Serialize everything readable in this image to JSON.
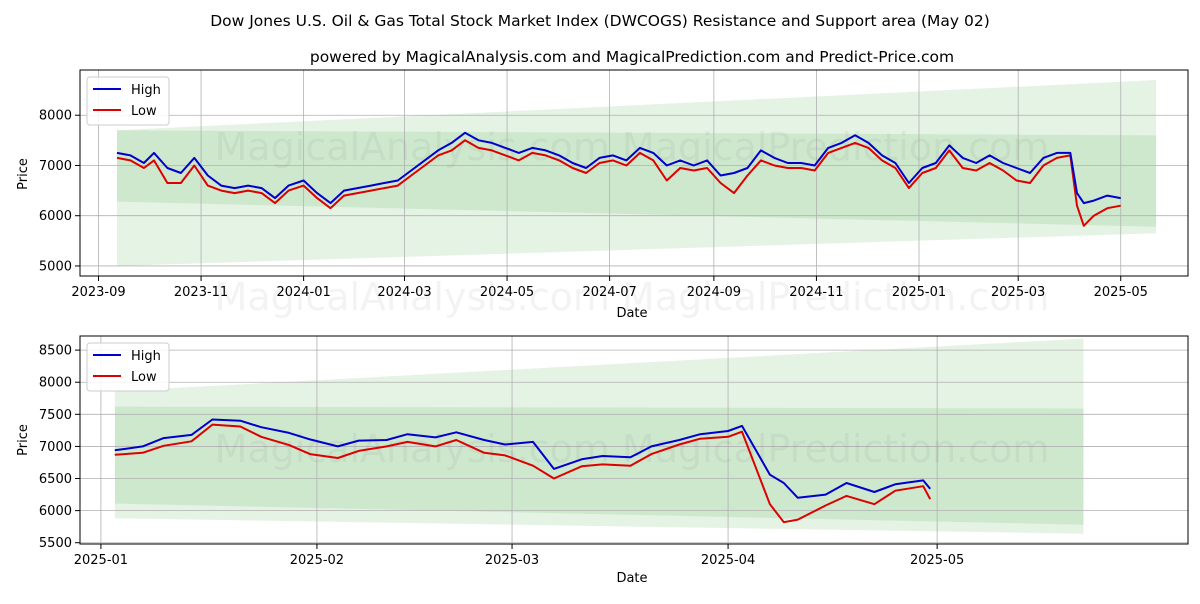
{
  "title": "Dow Jones U.S. Oil & Gas Total Stock Market Index (DWCOGS) Resistance and Support area (May 02)",
  "subtitle": "powered by MagicalAnalysis.com and MagicalPrediction.com and Predict-Price.com",
  "watermark": "MagicalAnalysis.com    MagicalPrediction.com",
  "colors": {
    "high": "#0000cc",
    "low": "#dd0000",
    "band": "#2ca02c",
    "grid": "#b0b0b0"
  },
  "chart_data": [
    {
      "type": "line",
      "xlabel": "Date",
      "ylabel": "Price",
      "legend_position": "top-left",
      "grid": true,
      "xlim": [
        "2023-08-21",
        "2025-06-10"
      ],
      "ylim": [
        4800,
        8900
      ],
      "x_ticks": [
        "2023-09",
        "2023-11",
        "2024-01",
        "2024-03",
        "2024-05",
        "2024-07",
        "2024-09",
        "2024-11",
        "2025-01",
        "2025-03",
        "2025-05"
      ],
      "y_ticks": [
        5000,
        6000,
        7000,
        8000
      ],
      "bands": [
        {
          "x": [
            "2023-09-12",
            "2025-05-22"
          ],
          "upper": [
            7700,
            8700
          ],
          "lower": [
            5000,
            5650
          ]
        },
        {
          "x": [
            "2023-09-12",
            "2025-05-22"
          ],
          "upper": [
            7700,
            7600
          ],
          "lower": [
            6280,
            5780
          ]
        },
        {
          "x": [
            "2023-09-12",
            "2025-05-22"
          ],
          "upper": [
            7600,
            5780
          ],
          "lower": [
            7600,
            5780
          ]
        }
      ],
      "series": [
        {
          "name": "High",
          "x": [
            "2023-09-12",
            "2023-09-20",
            "2023-09-28",
            "2023-10-04",
            "2023-10-12",
            "2023-10-20",
            "2023-10-28",
            "2023-11-05",
            "2023-11-13",
            "2023-11-21",
            "2023-11-29",
            "2023-12-07",
            "2023-12-15",
            "2023-12-23",
            "2024-01-01",
            "2024-01-09",
            "2024-01-17",
            "2024-01-25",
            "2024-02-02",
            "2024-02-10",
            "2024-02-18",
            "2024-02-26",
            "2024-03-05",
            "2024-03-13",
            "2024-03-21",
            "2024-03-29",
            "2024-04-06",
            "2024-04-14",
            "2024-04-22",
            "2024-04-30",
            "2024-05-08",
            "2024-05-16",
            "2024-05-24",
            "2024-06-01",
            "2024-06-09",
            "2024-06-17",
            "2024-06-25",
            "2024-07-03",
            "2024-07-11",
            "2024-07-19",
            "2024-07-27",
            "2024-08-04",
            "2024-08-12",
            "2024-08-20",
            "2024-08-28",
            "2024-09-05",
            "2024-09-13",
            "2024-09-21",
            "2024-09-29",
            "2024-10-07",
            "2024-10-15",
            "2024-10-23",
            "2024-10-31",
            "2024-11-08",
            "2024-11-16",
            "2024-11-24",
            "2024-12-02",
            "2024-12-10",
            "2024-12-18",
            "2024-12-26",
            "2025-01-03",
            "2025-01-11",
            "2025-01-19",
            "2025-01-27",
            "2025-02-04",
            "2025-02-12",
            "2025-02-20",
            "2025-02-28",
            "2025-03-08",
            "2025-03-16",
            "2025-03-24",
            "2025-04-01",
            "2025-04-05",
            "2025-04-09",
            "2025-04-15",
            "2025-04-23",
            "2025-05-01"
          ],
          "values": [
            7250,
            7200,
            7050,
            7250,
            6950,
            6850,
            7150,
            6800,
            6600,
            6550,
            6600,
            6550,
            6350,
            6600,
            6700,
            6450,
            6250,
            6500,
            6550,
            6600,
            6650,
            6700,
            6900,
            7100,
            7300,
            7450,
            7650,
            7500,
            7450,
            7350,
            7250,
            7350,
            7300,
            7200,
            7050,
            6950,
            7150,
            7200,
            7100,
            7350,
            7250,
            7000,
            7100,
            7000,
            7100,
            6800,
            6850,
            6950,
            7300,
            7150,
            7050,
            7050,
            7000,
            7350,
            7450,
            7600,
            7450,
            7200,
            7050,
            6650,
            6950,
            7050,
            7400,
            7150,
            7050,
            7200,
            7050,
            6950,
            6850,
            7150,
            7250,
            7250,
            6450,
            6250,
            6300,
            6400,
            6350
          ]
        },
        {
          "name": "Low",
          "x": [
            "2023-09-12",
            "2023-09-20",
            "2023-09-28",
            "2023-10-04",
            "2023-10-12",
            "2023-10-20",
            "2023-10-28",
            "2023-11-05",
            "2023-11-13",
            "2023-11-21",
            "2023-11-29",
            "2023-12-07",
            "2023-12-15",
            "2023-12-23",
            "2024-01-01",
            "2024-01-09",
            "2024-01-17",
            "2024-01-25",
            "2024-02-02",
            "2024-02-10",
            "2024-02-18",
            "2024-02-26",
            "2024-03-05",
            "2024-03-13",
            "2024-03-21",
            "2024-03-29",
            "2024-04-06",
            "2024-04-14",
            "2024-04-22",
            "2024-04-30",
            "2024-05-08",
            "2024-05-16",
            "2024-05-24",
            "2024-06-01",
            "2024-06-09",
            "2024-06-17",
            "2024-06-25",
            "2024-07-03",
            "2024-07-11",
            "2024-07-19",
            "2024-07-27",
            "2024-08-04",
            "2024-08-12",
            "2024-08-20",
            "2024-08-28",
            "2024-09-05",
            "2024-09-13",
            "2024-09-21",
            "2024-09-29",
            "2024-10-07",
            "2024-10-15",
            "2024-10-23",
            "2024-10-31",
            "2024-11-08",
            "2024-11-16",
            "2024-11-24",
            "2024-12-02",
            "2024-12-10",
            "2024-12-18",
            "2024-12-26",
            "2025-01-03",
            "2025-01-11",
            "2025-01-19",
            "2025-01-27",
            "2025-02-04",
            "2025-02-12",
            "2025-02-20",
            "2025-02-28",
            "2025-03-08",
            "2025-03-16",
            "2025-03-24",
            "2025-04-01",
            "2025-04-05",
            "2025-04-09",
            "2025-04-15",
            "2025-04-23",
            "2025-05-01"
          ],
          "values": [
            7150,
            7100,
            6950,
            7100,
            6650,
            6650,
            7000,
            6600,
            6500,
            6450,
            6500,
            6450,
            6250,
            6500,
            6600,
            6350,
            6150,
            6400,
            6450,
            6500,
            6550,
            6600,
            6800,
            7000,
            7200,
            7300,
            7500,
            7350,
            7300,
            7200,
            7100,
            7250,
            7200,
            7100,
            6950,
            6850,
            7050,
            7100,
            7000,
            7250,
            7100,
            6700,
            6950,
            6900,
            6950,
            6650,
            6450,
            6800,
            7100,
            7000,
            6950,
            6950,
            6900,
            7250,
            7350,
            7450,
            7350,
            7100,
            6950,
            6550,
            6850,
            6950,
            7300,
            6950,
            6900,
            7050,
            6900,
            6700,
            6650,
            7000,
            7150,
            7200,
            6200,
            5800,
            6000,
            6150,
            6200
          ]
        }
      ]
    },
    {
      "type": "line",
      "xlabel": "Date",
      "ylabel": "Price",
      "legend_position": "top-left",
      "grid": true,
      "xlim": [
        "2024-12-29",
        "2025-06-06"
      ],
      "ylim": [
        5480,
        8720
      ],
      "x_ticks": [
        "2025-01",
        "2025-02",
        "2025-03",
        "2025-04",
        "2025-05"
      ],
      "y_ticks": [
        5500,
        6000,
        6500,
        7000,
        7500,
        8000,
        8500
      ],
      "bands": [
        {
          "x": [
            "2025-01-03",
            "2025-05-22"
          ],
          "upper": [
            7860,
            8680
          ],
          "lower": [
            5880,
            5640
          ]
        },
        {
          "x": [
            "2025-01-03",
            "2025-05-22"
          ],
          "upper": [
            7620,
            7590
          ],
          "lower": [
            6110,
            5780
          ]
        }
      ],
      "series": [
        {
          "name": "High",
          "x": [
            "2025-01-03",
            "2025-01-07",
            "2025-01-10",
            "2025-01-14",
            "2025-01-17",
            "2025-01-21",
            "2025-01-24",
            "2025-01-28",
            "2025-01-31",
            "2025-02-04",
            "2025-02-07",
            "2025-02-11",
            "2025-02-14",
            "2025-02-18",
            "2025-02-21",
            "2025-02-25",
            "2025-02-28",
            "2025-03-04",
            "2025-03-07",
            "2025-03-11",
            "2025-03-14",
            "2025-03-18",
            "2025-03-21",
            "2025-03-25",
            "2025-03-28",
            "2025-04-01",
            "2025-04-03",
            "2025-04-07",
            "2025-04-09",
            "2025-04-11",
            "2025-04-15",
            "2025-04-18",
            "2025-04-22",
            "2025-04-25",
            "2025-04-29",
            "2025-04-30"
          ],
          "values": [
            6940,
            7000,
            7130,
            7180,
            7420,
            7400,
            7300,
            7210,
            7110,
            7000,
            7090,
            7100,
            7190,
            7140,
            7220,
            7100,
            7030,
            7070,
            6650,
            6800,
            6850,
            6830,
            7000,
            7100,
            7190,
            7240,
            7320,
            6560,
            6430,
            6200,
            6250,
            6430,
            6290,
            6410,
            6470,
            6340
          ]
        },
        {
          "name": "Low",
          "x": [
            "2025-01-03",
            "2025-01-07",
            "2025-01-10",
            "2025-01-14",
            "2025-01-17",
            "2025-01-21",
            "2025-01-24",
            "2025-01-28",
            "2025-01-31",
            "2025-02-04",
            "2025-02-07",
            "2025-02-11",
            "2025-02-14",
            "2025-02-18",
            "2025-02-21",
            "2025-02-25",
            "2025-02-28",
            "2025-03-04",
            "2025-03-07",
            "2025-03-11",
            "2025-03-14",
            "2025-03-18",
            "2025-03-21",
            "2025-03-25",
            "2025-03-28",
            "2025-04-01",
            "2025-04-03",
            "2025-04-07",
            "2025-04-09",
            "2025-04-11",
            "2025-04-15",
            "2025-04-18",
            "2025-04-22",
            "2025-04-25",
            "2025-04-29",
            "2025-04-30"
          ],
          "values": [
            6870,
            6900,
            7010,
            7080,
            7340,
            7310,
            7150,
            7020,
            6880,
            6820,
            6930,
            7000,
            7070,
            7000,
            7100,
            6900,
            6860,
            6700,
            6500,
            6690,
            6720,
            6700,
            6880,
            7030,
            7120,
            7150,
            7230,
            6100,
            5820,
            5860,
            6080,
            6230,
            6100,
            6310,
            6380,
            6180
          ]
        }
      ]
    }
  ]
}
